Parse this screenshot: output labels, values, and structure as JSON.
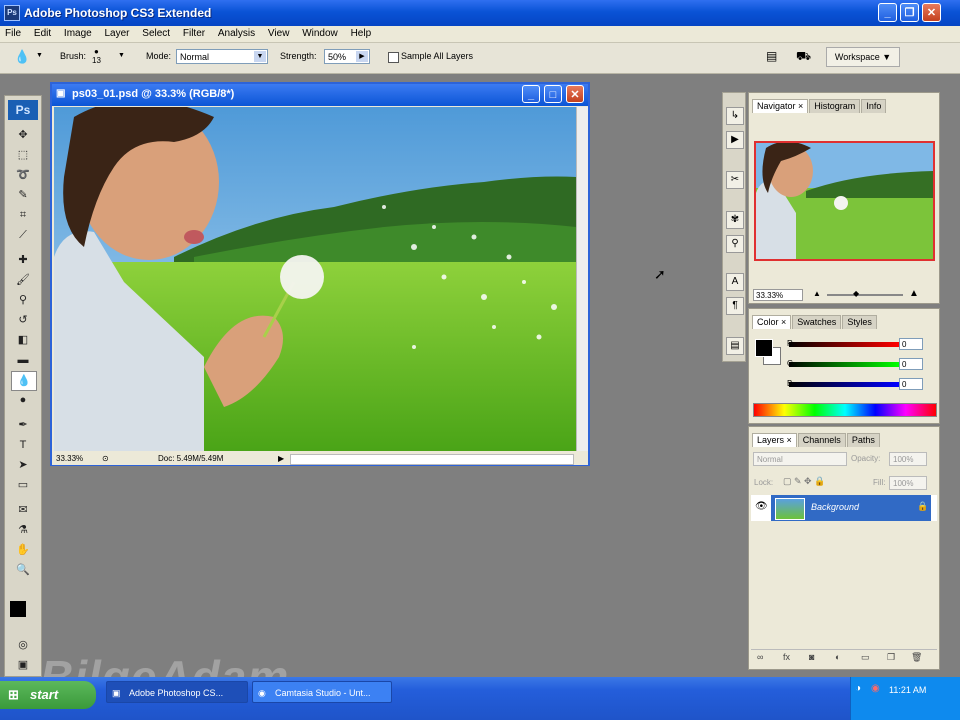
{
  "app": {
    "title": "Adobe Photoshop CS3 Extended",
    "icon_badge": "Ps"
  },
  "window_buttons": [
    "minimize-icon",
    "restore-icon",
    "close-icon"
  ],
  "menu": [
    "File",
    "Edit",
    "Image",
    "Layer",
    "Select",
    "Filter",
    "Analysis",
    "View",
    "Window",
    "Help"
  ],
  "options": {
    "brush_label": "Brush:",
    "brush_size": "13",
    "mode_label": "Mode:",
    "mode_value": "Normal",
    "strength_label": "Strength:",
    "strength_value": "50%",
    "sample_all_layers": "Sample All Layers",
    "workspace": "Workspace"
  },
  "toolbox": {
    "logo": "Ps"
  },
  "document": {
    "title": "ps03_01.psd @ 33.3% (RGB/8*)",
    "zoom": "33.33%",
    "doc_info": "Doc: 5.49M/5.49M"
  },
  "navigator": {
    "tabs": [
      "Navigator",
      "Histogram",
      "Info"
    ],
    "zoom": "33.33%"
  },
  "color_panel": {
    "tabs": [
      "Color",
      "Swatches",
      "Styles"
    ],
    "channels": [
      {
        "label": "R",
        "value": "0"
      },
      {
        "label": "G",
        "value": "0"
      },
      {
        "label": "B",
        "value": "0"
      }
    ]
  },
  "layers_panel": {
    "tabs": [
      "Layers",
      "Channels",
      "Paths"
    ],
    "blend_mode": "Normal",
    "opacity_label": "Opacity:",
    "opacity_value": "100%",
    "lock_label": "Lock:",
    "fill_label": "Fill:",
    "fill_value": "100%",
    "layers": [
      {
        "name": "Background",
        "locked": true,
        "visible": true
      }
    ]
  },
  "taskbar": {
    "start": "start",
    "items": [
      "Adobe Photoshop CS...",
      "Camtasia Studio - Unt..."
    ],
    "clock": "11:21 AM"
  },
  "watermark": "BilgeAdam",
  "colors": {
    "xp_blue": "#0a53d6",
    "panel_bg": "#ece9d8",
    "workspace_gray": "#7f7f7f",
    "selected_layer": "#316ac5"
  }
}
